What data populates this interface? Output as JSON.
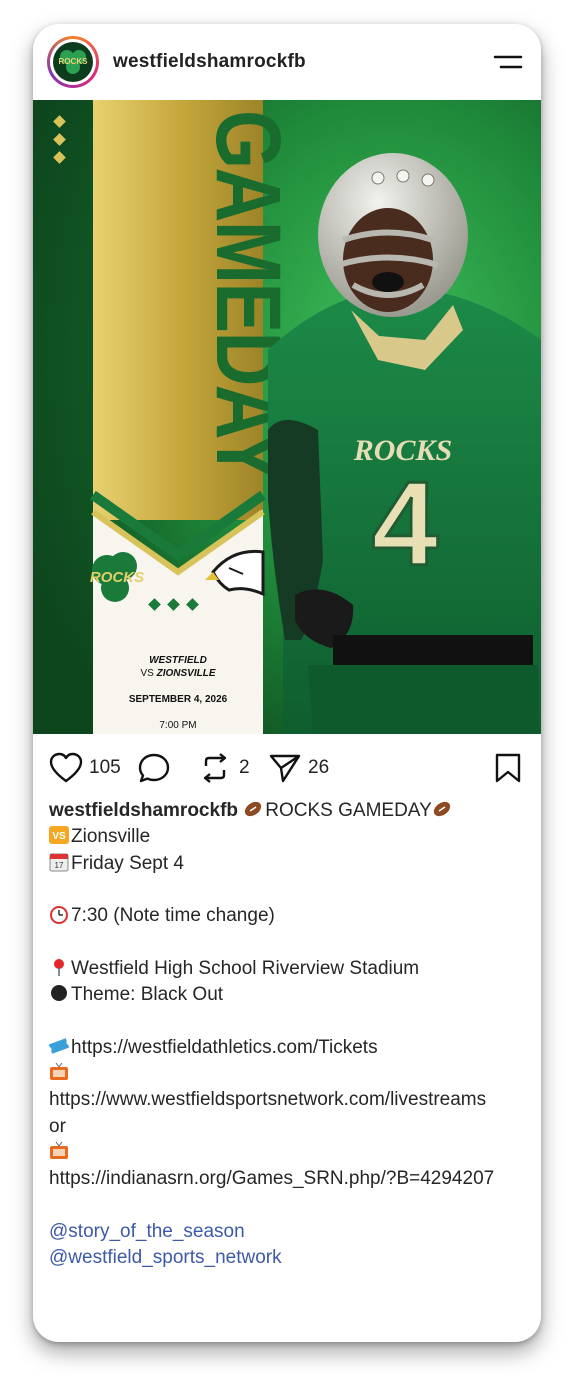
{
  "header": {
    "username": "westfieldshamrockfb",
    "avatar_text": "ROCKS"
  },
  "poster": {
    "title": "GAMEDAY",
    "home_team": "WESTFIELD",
    "vs_prefix": "VS",
    "away_team": "ZIONSVILLE",
    "date": "SEPTEMBER 4, 2026",
    "time": "7:00 PM",
    "left_logo_text": "ROCKS",
    "jersey_text": "ROCKS",
    "jersey_number": "4",
    "colors": {
      "green": "#1a7a3a",
      "gold": "#cdb24a",
      "dark_green": "#0e3d1c"
    }
  },
  "actions": {
    "likes": "105",
    "reposts": "2",
    "shares": "26"
  },
  "caption": {
    "username": "westfieldshamrockfb",
    "headline": "ROCKS GAMEDAY",
    "vs_badge": "VS",
    "opponent": "Zionsville",
    "date_line": "Friday Sept 4",
    "time_line": "7:30 (Note time change)",
    "location_line": "Westfield High School Riverview Stadium",
    "theme_line": "Theme: Black Out",
    "tickets_url": "https://westfieldathletics.com/Tickets",
    "stream_url_1": "https://www.westfieldsportsnetwork.com/livestreams",
    "or_text": "or",
    "stream_url_2": "https://indianasrn.org/Games_SRN.php/?B=4294207",
    "mention_1": "@story_of_the_season",
    "mention_2": "@westfield_sports_network"
  }
}
